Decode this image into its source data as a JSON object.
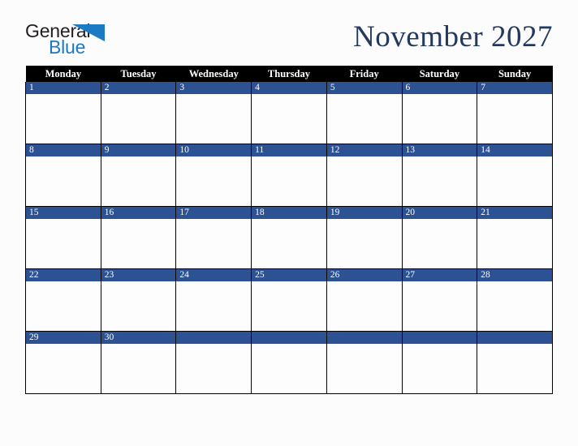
{
  "header": {
    "logo": {
      "line1": "General",
      "line2": "Blue",
      "triangle_icon": "triangle-icon",
      "line1_color": "#231f20",
      "line2_color": "#1a7ac4",
      "triangle_color": "#1a7ac4"
    },
    "month_title": "November 2027"
  },
  "calendar": {
    "accent_color": "#2d5294",
    "header_bg": "#000000",
    "header_text_color": "#ffffff",
    "cell_bg": "#fdfdfd",
    "weekday_headers": [
      "Monday",
      "Tuesday",
      "Wednesday",
      "Thursday",
      "Friday",
      "Saturday",
      "Sunday"
    ],
    "weeks": [
      [
        {
          "day": "1"
        },
        {
          "day": "2"
        },
        {
          "day": "3"
        },
        {
          "day": "4"
        },
        {
          "day": "5"
        },
        {
          "day": "6"
        },
        {
          "day": "7"
        }
      ],
      [
        {
          "day": "8"
        },
        {
          "day": "9"
        },
        {
          "day": "10"
        },
        {
          "day": "11"
        },
        {
          "day": "12"
        },
        {
          "day": "13"
        },
        {
          "day": "14"
        }
      ],
      [
        {
          "day": "15"
        },
        {
          "day": "16"
        },
        {
          "day": "17"
        },
        {
          "day": "18"
        },
        {
          "day": "19"
        },
        {
          "day": "20"
        },
        {
          "day": "21"
        }
      ],
      [
        {
          "day": "22"
        },
        {
          "day": "23"
        },
        {
          "day": "24"
        },
        {
          "day": "25"
        },
        {
          "day": "26"
        },
        {
          "day": "27"
        },
        {
          "day": "28"
        }
      ],
      [
        {
          "day": "29"
        },
        {
          "day": "30"
        },
        {
          "day": ""
        },
        {
          "day": ""
        },
        {
          "day": ""
        },
        {
          "day": ""
        },
        {
          "day": ""
        }
      ]
    ]
  }
}
